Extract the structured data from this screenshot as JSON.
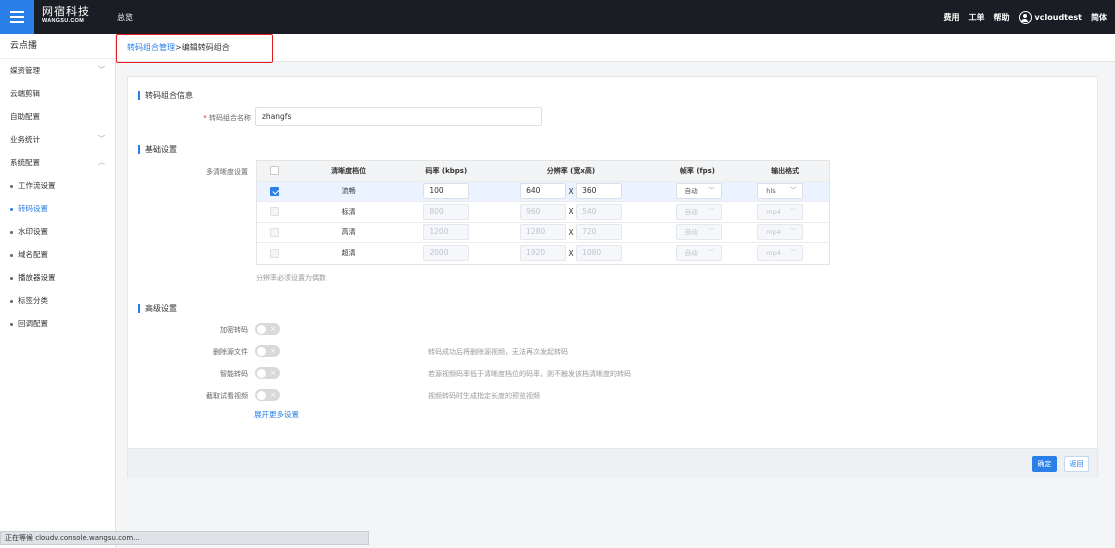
{
  "topbar": {
    "logo_cn": "网宿科技",
    "logo_en": "WANGSU.COM",
    "nav_overview": "总览",
    "links": [
      "费用",
      "工单",
      "帮助"
    ],
    "username": "vcloudtest",
    "language": "简体"
  },
  "sidebar": {
    "title": "云点播",
    "items": [
      {
        "label": "媒资管理",
        "chevron": "﹀"
      },
      {
        "label": "云端剪辑",
        "chevron": ""
      },
      {
        "label": "自助配置",
        "chevron": ""
      },
      {
        "label": "业务统计",
        "chevron": "﹀"
      },
      {
        "label": "系统配置",
        "chevron": "︿"
      }
    ],
    "subitems": [
      {
        "label": "工作流设置",
        "active": false
      },
      {
        "label": "转码设置",
        "active": true
      },
      {
        "label": "水印设置",
        "active": false
      },
      {
        "label": "域名配置",
        "active": false
      },
      {
        "label": "播放器设置",
        "active": false
      },
      {
        "label": "标签分类",
        "active": false
      },
      {
        "label": "回调配置",
        "active": false
      }
    ],
    "accent_color": "#2a7fe8"
  },
  "breadcrumb": {
    "parent": "转码组合管理",
    "separator": ">",
    "current": "编辑转码组合"
  },
  "form": {
    "info_section": "转码组合信息",
    "name_label": "转码组合名称",
    "name_required_mark": "*",
    "name_value": "zhangfs",
    "basic_section": "基础设置",
    "multi_res_label": "多清晰度设置",
    "table": {
      "headers": {
        "level": "清晰度档位",
        "bitrate": "码率 (kbps)",
        "resolution": "分辨率 (宽x高)",
        "fps": "帧率 (fps)",
        "format": "输出格式"
      },
      "x_sep": "X",
      "rows": [
        {
          "checked": true,
          "level": "流畅",
          "bitrate": "100",
          "width": "640",
          "height": "360",
          "fps": "自动",
          "format": "hls",
          "enabled": true
        },
        {
          "checked": false,
          "level": "标清",
          "bitrate": "800",
          "width": "960",
          "height": "540",
          "fps": "自动",
          "format": "mp4",
          "enabled": false
        },
        {
          "checked": false,
          "level": "高清",
          "bitrate": "1200",
          "width": "1280",
          "height": "720",
          "fps": "自动",
          "format": "mp4",
          "enabled": false
        },
        {
          "checked": false,
          "level": "超清",
          "bitrate": "2000",
          "width": "1920",
          "height": "1080",
          "fps": "自动",
          "format": "mp4",
          "enabled": false
        }
      ]
    },
    "resolution_note": "分辨率必须设置为偶数",
    "advanced_section": "高级设置",
    "advanced": [
      {
        "label": "加密转码",
        "desc": ""
      },
      {
        "label": "删除源文件",
        "desc": "转码成功后将删除源视频，无法再次发起转码"
      },
      {
        "label": "智能转码",
        "desc": "若源视频码率低于清晰度档位的码率，则不触发该档清晰度的转码"
      },
      {
        "label": "截取试看视频",
        "desc": "视频转码时生成指定长度的预览视频"
      }
    ],
    "toggle_off_mark": "×",
    "expand_more": "展开更多设置",
    "ok_button": "确定",
    "back_button": "返回"
  },
  "status_bar": "正在等候 cloudv.console.wangsu.com..."
}
